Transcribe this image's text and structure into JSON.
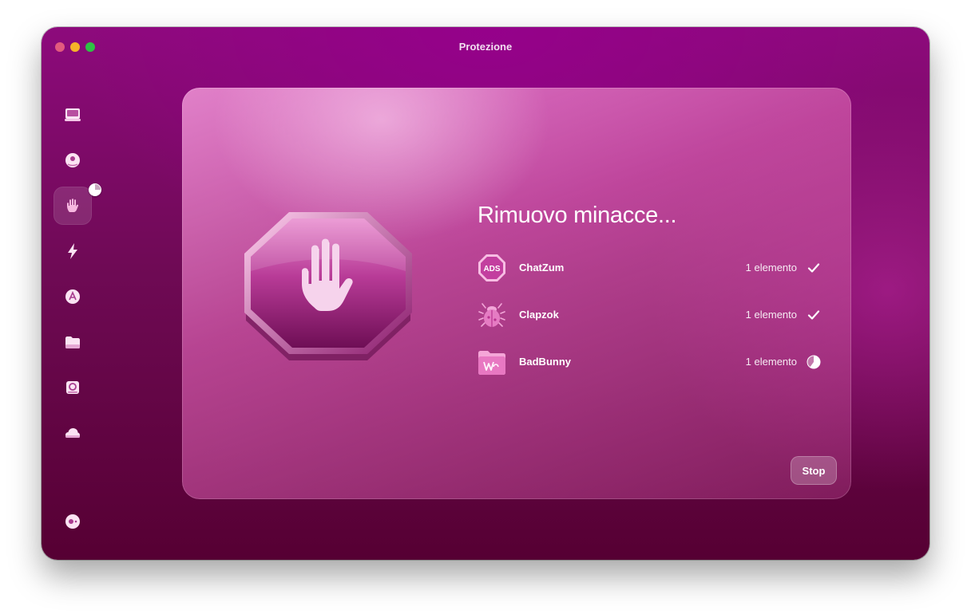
{
  "window": {
    "title": "Protezione"
  },
  "sidebar": {
    "items": [
      {
        "icon": "monitor-icon",
        "active": false
      },
      {
        "icon": "privacy-ball-icon",
        "active": false
      },
      {
        "icon": "hand-stop-icon",
        "active": true
      },
      {
        "icon": "lightning-icon",
        "active": false
      },
      {
        "icon": "applications-icon",
        "active": false
      },
      {
        "icon": "folder-icon",
        "active": false
      },
      {
        "icon": "disk-search-icon",
        "active": false
      },
      {
        "icon": "cloud-icon",
        "active": false
      }
    ],
    "footer_icon": "assistant-icon"
  },
  "main": {
    "heading": "Rimuovo minacce...",
    "threats": [
      {
        "name": "ChatZum",
        "count": "1 elemento",
        "status": "done",
        "icon": "ads-badge-icon",
        "icon_text": "ADS"
      },
      {
        "name": "Clapzok",
        "count": "1 elemento",
        "status": "done",
        "icon": "bug-icon"
      },
      {
        "name": "BadBunny",
        "count": "1 elemento",
        "status": "in-progress",
        "progress": 0.6,
        "icon": "folder-w-icon"
      }
    ],
    "stop_label": "Stop"
  },
  "colors": {
    "accent": "#a0168c",
    "window_bg_top": "#8d0a7c",
    "window_bg_bottom": "#560033",
    "traffic_close": "#e25a7e",
    "traffic_min": "#f5b428",
    "traffic_max": "#2fc145"
  }
}
